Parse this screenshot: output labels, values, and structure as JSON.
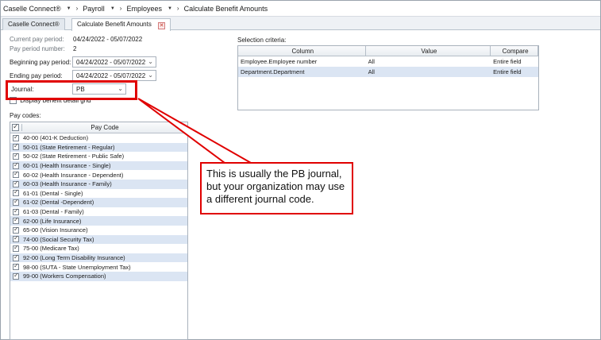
{
  "breadcrumb": [
    {
      "label": "Caselle Connect®"
    },
    {
      "label": "Payroll"
    },
    {
      "label": "Employees"
    },
    {
      "label": "Calculate Benefit Amounts"
    }
  ],
  "tabs": [
    {
      "label": "Caselle Connect®",
      "active": false
    },
    {
      "label": "Calculate Benefit Amounts",
      "active": true
    }
  ],
  "form": {
    "current_pay_period_label": "Current pay period:",
    "current_pay_period_value": "04/24/2022 - 05/07/2022",
    "pay_period_number_label": "Pay period number:",
    "pay_period_number_value": "2",
    "beginning_pay_period_label": "Beginning pay period:",
    "beginning_pay_period_value": "04/24/2022 - 05/07/2022",
    "ending_pay_period_label": "Ending pay period:",
    "ending_pay_period_value": "04/24/2022 - 05/07/2022",
    "journal_label": "Journal:",
    "journal_value": "PB",
    "display_detail_label": "Display benefit detail grid",
    "pay_codes_label": "Pay codes:"
  },
  "pay_codes": {
    "header": "Pay Code",
    "rows": [
      {
        "label": "40-00 (401-K Deduction)",
        "checked": true
      },
      {
        "label": "50-01 (State Retirement - Regular)",
        "checked": true
      },
      {
        "label": "50-02 (State Retirement - Public Safe)",
        "checked": true
      },
      {
        "label": "60-01 (Health Insurance - Single)",
        "checked": true
      },
      {
        "label": "60-02 (Health Insurance - Dependent)",
        "checked": true
      },
      {
        "label": "60-03 (Health Insurance - Family)",
        "checked": true
      },
      {
        "label": "61-01 (Dental - Single)",
        "checked": true
      },
      {
        "label": "61-02 (Dental -Dependent)",
        "checked": true
      },
      {
        "label": "61-03 (Dental - Family)",
        "checked": true
      },
      {
        "label": "62-00 (Life Insurance)",
        "checked": true
      },
      {
        "label": "65-00 (Vision Insurance)",
        "checked": true
      },
      {
        "label": "74-00 (Social Security Tax)",
        "checked": true
      },
      {
        "label": "75-00 (Medicare Tax)",
        "checked": true
      },
      {
        "label": "92-00 (Long Term Disability Insurance)",
        "checked": true
      },
      {
        "label": "98-00 (SUTA - State Unemployment Tax)",
        "checked": true
      },
      {
        "label": "99-00 (Workers Compensation)",
        "checked": true
      }
    ]
  },
  "selection_criteria": {
    "label": "Selection criteria:",
    "headers": [
      "Column",
      "Value",
      "Compare"
    ],
    "rows": [
      [
        "Employee.Employee number",
        "All",
        "Entire field"
      ],
      [
        "Department.Department",
        "All",
        "Entire field"
      ]
    ]
  },
  "callout": {
    "text": "This is usually the PB journal, but your organization may use a different journal code."
  },
  "colors": {
    "callout_border": "#e00000",
    "row_alt": "#dbe5f3"
  }
}
